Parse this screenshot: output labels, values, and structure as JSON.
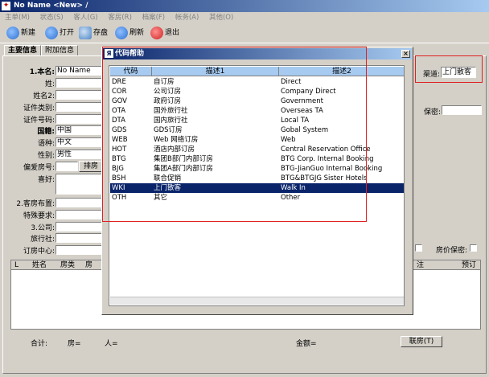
{
  "window": {
    "title": "No Name <New> /",
    "app_icon": "app-logo-icon"
  },
  "menu": [
    "主单(M)",
    "状态(S)",
    "客人(G)",
    "客房(R)",
    "档案(F)",
    "帐务(A)",
    "其他(O)"
  ],
  "toolbar": [
    {
      "label": "新建",
      "icon": "new-icon",
      "color": "#2c6fd1"
    },
    {
      "label": "打开",
      "icon": "open-icon",
      "color": "#2c6fd1"
    },
    {
      "label": "存盘",
      "icon": "save-icon",
      "color": "#4a86c5"
    },
    {
      "label": "刷新",
      "icon": "refresh-icon",
      "color": "#2c6fd1"
    },
    {
      "label": "退出",
      "icon": "exit-icon",
      "color": "#d02020"
    }
  ],
  "tabs": [
    "主要信息",
    "附加信息"
  ],
  "form": {
    "name_label": "1.本名:",
    "name_value": "No Name",
    "surname_label": "姓:",
    "name2_label": "姓名2:",
    "idtype_label": "证件类别:",
    "idno_label": "证件号码:",
    "country_label": "国籍:",
    "country_value": "中国",
    "lang_label": "语种:",
    "lang_value": "中文",
    "gender_label": "性别:",
    "gender_value": "男性",
    "room_pref_label": "偏爱房号:",
    "room_sort_btn": "排房",
    "hobby_label": "喜好:",
    "layout_label": "2.客房布置:",
    "special_label": "特殊要求:",
    "company_label": "3.公司:",
    "agency_label": "旅行社:",
    "center_label": "订房中心:",
    "channel_label": "渠道:",
    "channel_value": "上门散客",
    "secret_label": "保密:",
    "price_secret_label": "房价保密:"
  },
  "grid": {
    "columns": [
      "L",
      "姓名",
      "房类",
      "房",
      "注",
      "预订"
    ]
  },
  "footer": {
    "total_label": "合计:",
    "rooms_label": "房=",
    "people_label": "人=",
    "amount_label": "金额=",
    "room_btn": "联房(T)"
  },
  "dialog": {
    "title": "代码帮助",
    "close": "×",
    "columns": [
      "代码",
      "描述1",
      "描述2"
    ],
    "rows": [
      {
        "code": "DRE",
        "desc1": "自订房",
        "desc2": "Direct"
      },
      {
        "code": "COR",
        "desc1": "公司订房",
        "desc2": "Company Direct"
      },
      {
        "code": "GOV",
        "desc1": "政府订房",
        "desc2": "Government"
      },
      {
        "code": "OTA",
        "desc1": "国外旅行社",
        "desc2": "Overseas TA"
      },
      {
        "code": "DTA",
        "desc1": "国内旅行社",
        "desc2": "Local TA"
      },
      {
        "code": "GDS",
        "desc1": "GDS订房",
        "desc2": "Gobal System"
      },
      {
        "code": "WEB",
        "desc1": "Web 网络订房",
        "desc2": "Web"
      },
      {
        "code": "HOT",
        "desc1": "酒店内部订房",
        "desc2": "Central Reservation Office"
      },
      {
        "code": "BTG",
        "desc1": "集团B部门内部订房",
        "desc2": "BTG Corp. Internal Booking"
      },
      {
        "code": "BJG",
        "desc1": "集团A部门内部订房",
        "desc2": "BTG-JianGuo Internal Booking"
      },
      {
        "code": "BSH",
        "desc1": "联合促销",
        "desc2": "BTG&BTGJG Sister Hotels"
      },
      {
        "code": "WKI",
        "desc1": "上门散客",
        "desc2": "Walk In",
        "selected": true
      },
      {
        "code": "OTH",
        "desc1": "其它",
        "desc2": "Other"
      }
    ]
  }
}
